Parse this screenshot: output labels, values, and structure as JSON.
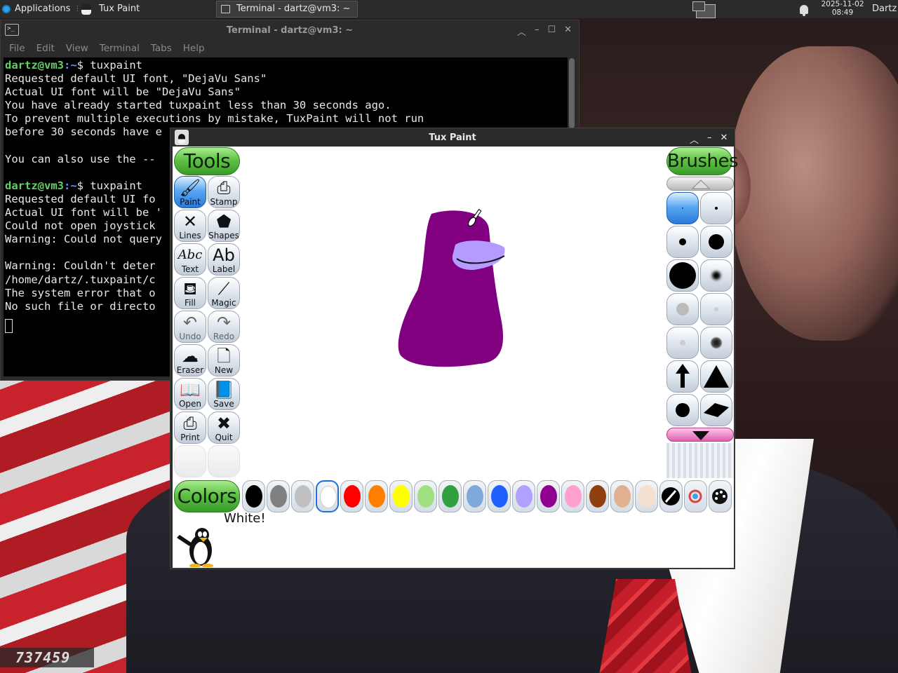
{
  "panel": {
    "applications_label": "Applications",
    "tasks": [
      {
        "label": "Tux Paint"
      },
      {
        "label": "Terminal - dartz@vm3: ~"
      }
    ],
    "clock_date": "2025-11-02",
    "clock_time": "08:49",
    "user": "Dartz"
  },
  "terminal": {
    "title": "Terminal - dartz@vm3: ~",
    "menu": [
      "File",
      "Edit",
      "View",
      "Terminal",
      "Tabs",
      "Help"
    ],
    "lines": [
      {
        "user": "dartz@vm3",
        "path": ":~",
        "cmd": "$ tuxpaint"
      },
      {
        "text": "Requested default UI font, \"DejaVu Sans\""
      },
      {
        "text": "Actual UI font will be \"DejaVu Sans\""
      },
      {
        "text": "You have already started tuxpaint less than 30 seconds ago."
      },
      {
        "text": "To prevent multiple executions by mistake, TuxPaint will not run"
      },
      {
        "text": "before 30 seconds have e"
      },
      {
        "text": ""
      },
      {
        "text": "You can also use the --"
      },
      {
        "text": ""
      },
      {
        "user": "dartz@vm3",
        "path": ":~",
        "cmd": "$ tuxpaint"
      },
      {
        "text": "Requested default UI fo"
      },
      {
        "text": "Actual UI font will be '"
      },
      {
        "text": "Could not open joystick"
      },
      {
        "text": "Warning: Could not query"
      },
      {
        "text": ""
      },
      {
        "text": "Warning: Couldn't deter"
      },
      {
        "text": "/home/dartz/.tuxpaint/c"
      },
      {
        "text": "The system error that o"
      },
      {
        "text": "No such file or directo"
      }
    ]
  },
  "tuxpaint": {
    "title": "Tux Paint",
    "tools_header": "Tools",
    "brushes_header": "Brushes",
    "colors_header": "Colors",
    "tools": [
      {
        "label": "Paint",
        "icon": "paintbrush-icon",
        "glyph": "🖌",
        "selected": true
      },
      {
        "label": "Stamp",
        "icon": "stamp-icon",
        "glyph": "⎙",
        "selected": false
      },
      {
        "label": "Lines",
        "icon": "lines-icon",
        "glyph": "✕",
        "selected": false
      },
      {
        "label": "Shapes",
        "icon": "pentagon-icon",
        "glyph": "⬟",
        "selected": false
      },
      {
        "label": "Text",
        "icon": "text-icon",
        "glyph": "Abc",
        "selected": false
      },
      {
        "label": "Label",
        "icon": "label-icon",
        "glyph": "Ab",
        "selected": false
      },
      {
        "label": "Fill",
        "icon": "bucket-icon",
        "glyph": "⛾",
        "selected": false
      },
      {
        "label": "Magic",
        "icon": "magic-wand-icon",
        "glyph": "⟋",
        "selected": false
      },
      {
        "label": "Undo",
        "icon": "undo-icon",
        "glyph": "↶",
        "selected": false,
        "dim": true
      },
      {
        "label": "Redo",
        "icon": "redo-icon",
        "glyph": "↷",
        "selected": false,
        "dim": true
      },
      {
        "label": "Eraser",
        "icon": "eraser-icon",
        "glyph": "☁",
        "selected": false
      },
      {
        "label": "New",
        "icon": "new-page-icon",
        "glyph": "🗋",
        "selected": false
      },
      {
        "label": "Open",
        "icon": "open-book-icon",
        "glyph": "📖",
        "selected": false
      },
      {
        "label": "Save",
        "icon": "save-book-icon",
        "glyph": "📘",
        "selected": false
      },
      {
        "label": "Print",
        "icon": "printer-icon",
        "glyph": "⎙",
        "selected": false
      },
      {
        "label": "Quit",
        "icon": "quit-icon",
        "glyph": "✖",
        "selected": false
      }
    ],
    "brushes": [
      {
        "icon": "tiny-dot-brush-icon",
        "selected": true
      },
      {
        "icon": "small-dot-brush-icon"
      },
      {
        "icon": "medium-dot-brush-icon"
      },
      {
        "icon": "large-dot-brush-icon"
      },
      {
        "icon": "xlarge-dot-brush-icon"
      },
      {
        "icon": "fuzzy-dot-brush-icon"
      },
      {
        "icon": "soft-grey-brush-icon"
      },
      {
        "icon": "soft-light-brush-icon"
      },
      {
        "icon": "faint-dot-brush-icon"
      },
      {
        "icon": "spray-brush-icon"
      },
      {
        "icon": "arrow-brush-icon"
      },
      {
        "icon": "triangle-brush-icon"
      },
      {
        "icon": "circle-brush-icon"
      },
      {
        "icon": "diamond-brush-icon"
      }
    ],
    "colors": [
      {
        "name": "black",
        "hex": "#000000"
      },
      {
        "name": "dark-grey",
        "hex": "#808080"
      },
      {
        "name": "light-grey",
        "hex": "#c0c0c0"
      },
      {
        "name": "white",
        "hex": "#ffffff",
        "selected": true
      },
      {
        "name": "red",
        "hex": "#ff0000"
      },
      {
        "name": "orange",
        "hex": "#ff8000"
      },
      {
        "name": "yellow",
        "hex": "#ffff00"
      },
      {
        "name": "light-green",
        "hex": "#a0e080"
      },
      {
        "name": "dark-green",
        "hex": "#30a040"
      },
      {
        "name": "sky-blue",
        "hex": "#80a8d8"
      },
      {
        "name": "blue",
        "hex": "#2060ff"
      },
      {
        "name": "lavender",
        "hex": "#b0a0ff"
      },
      {
        "name": "purple",
        "hex": "#900090"
      },
      {
        "name": "pink",
        "hex": "#ffa0d0"
      },
      {
        "name": "brown",
        "hex": "#904010"
      },
      {
        "name": "tan",
        "hex": "#e0b090"
      },
      {
        "name": "beige",
        "hex": "#f5e0d0"
      }
    ],
    "drawing_colors": {
      "body": "#800080",
      "beak": "#b39bff",
      "accent": "#aa88ff"
    },
    "tip": "White!"
  },
  "wallpaper_number": "737459"
}
